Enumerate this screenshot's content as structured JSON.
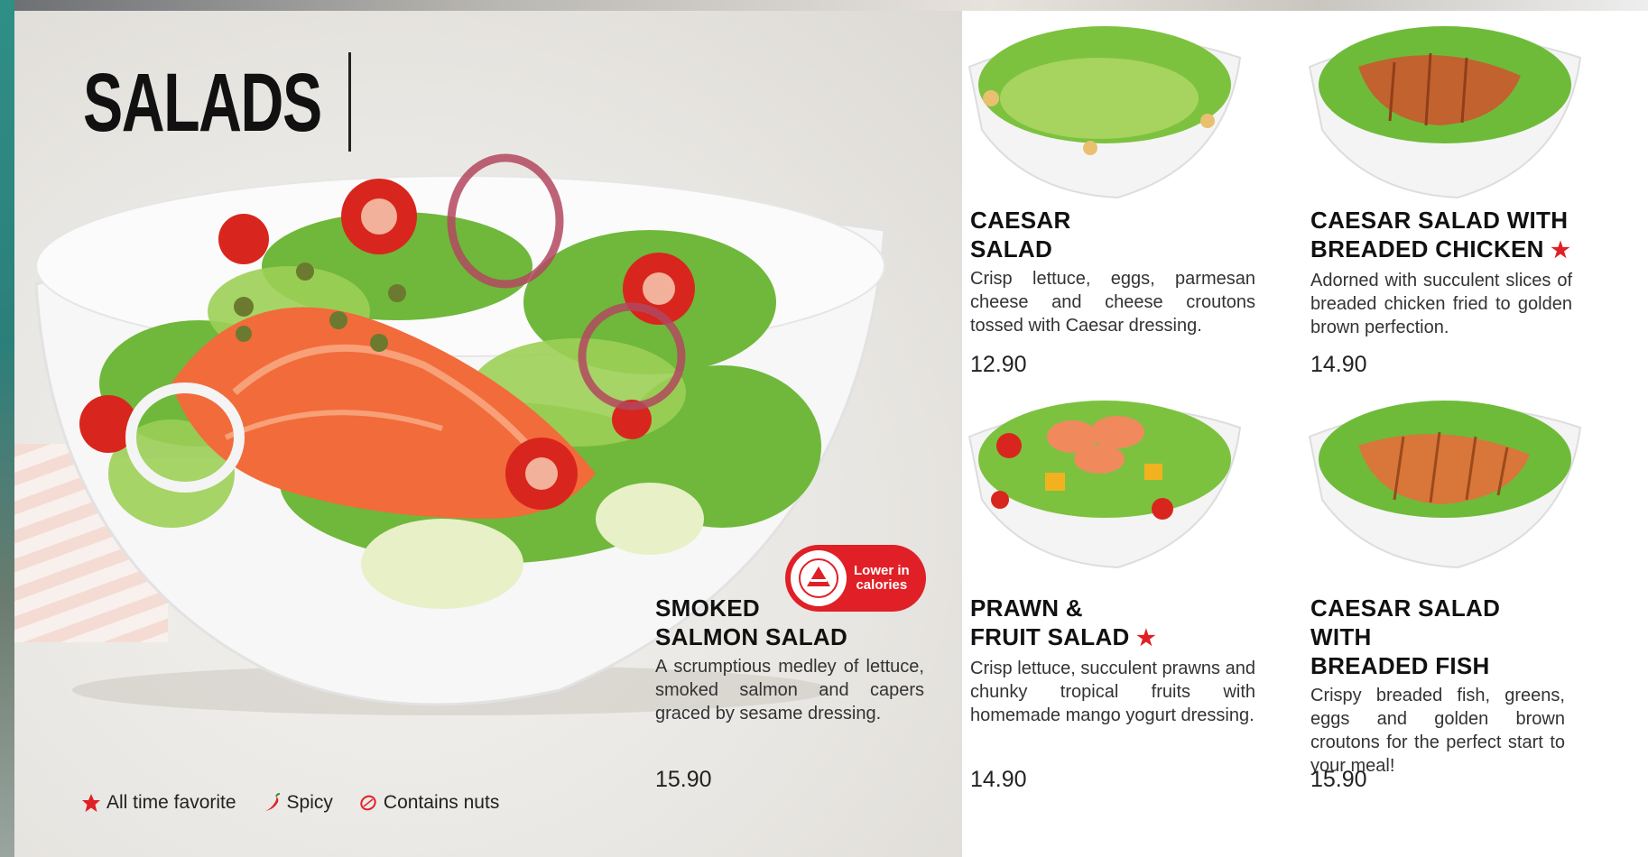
{
  "section_title": "SALADS",
  "badge": {
    "line1": "Lower in",
    "line2": "calories"
  },
  "featured": {
    "name_line1": "SMOKED",
    "name_line2": "SALMON SALAD",
    "description": "A scrumptious medley of lettuce, smoked salmon and capers graced by sesame dressing.",
    "price": "15.90"
  },
  "items": [
    {
      "name_line1": "CAESAR",
      "name_line2": "SALAD",
      "favorite": false,
      "description": "Crisp lettuce, eggs, parmesan cheese and cheese croutons tossed with Caesar dressing.",
      "price": "12.90"
    },
    {
      "name_line1": "CAESAR SALAD WITH",
      "name_line2": "BREADED CHICKEN",
      "favorite": true,
      "description": "Adorned with succulent slices of breaded chicken fried to golden brown perfection.",
      "price": "14.90"
    },
    {
      "name_line1": "PRAWN &",
      "name_line2": "FRUIT SALAD",
      "favorite": true,
      "description": "Crisp lettuce, succulent prawns and chunky tropical fruits with homemade mango yogurt dressing.",
      "price": "14.90"
    },
    {
      "name_line1": "CAESAR SALAD WITH",
      "name_line2": "BREADED FISH",
      "favorite": false,
      "description": "Crispy breaded fish, greens, eggs and golden brown croutons for the perfect start to your meal!",
      "price": "15.90"
    }
  ],
  "legend": {
    "favorite": "All time favorite",
    "spicy": "Spicy",
    "nuts": "Contains nuts"
  },
  "colors": {
    "accent_red": "#e02026",
    "text": "#1a1a1a"
  },
  "icons": [
    "star-icon",
    "chili-icon",
    "nut-icon",
    "healthier-choice-logo"
  ]
}
